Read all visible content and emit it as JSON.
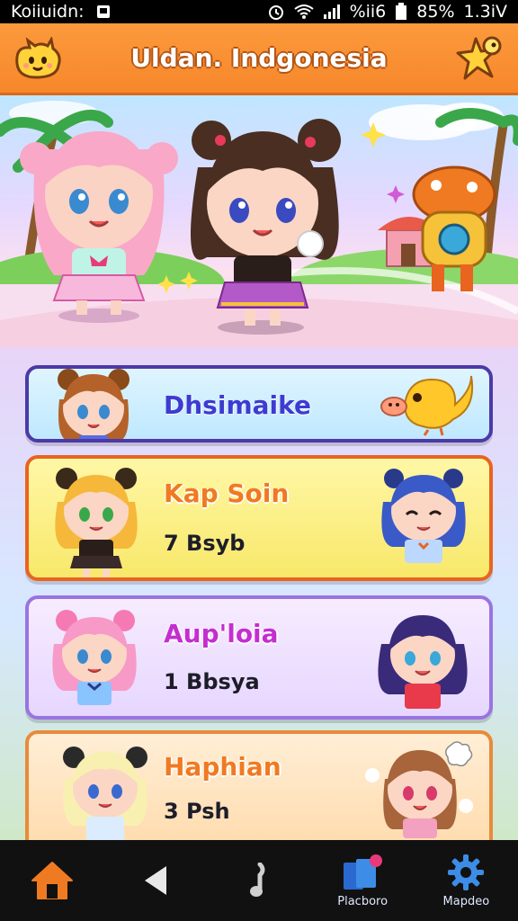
{
  "status_bar": {
    "left_text": "Koiiuidn:",
    "battery_text": "%ii6",
    "percent": "85%",
    "time": "1.3iV"
  },
  "header": {
    "title": "Uldan. Indgonesia",
    "left_icon": "mascot-icon",
    "right_icon": "star-sparkle-icon"
  },
  "cards": [
    {
      "title": "Dhsimaike",
      "subtitle": ""
    },
    {
      "title": "Kap Soin",
      "subtitle": "7 Bsyb"
    },
    {
      "title": "Aup'loia",
      "subtitle": "1 Bbsya"
    },
    {
      "title": "Haphian",
      "subtitle": "3 Psh"
    }
  ],
  "bottom_nav": {
    "items": [
      {
        "icon": "home-icon",
        "label": ""
      },
      {
        "icon": "back-icon",
        "label": ""
      },
      {
        "icon": "music-note-icon",
        "label": ""
      },
      {
        "icon": "cards-icon",
        "label": "Placboro"
      },
      {
        "icon": "gear-icon",
        "label": "Mapdeo"
      }
    ]
  },
  "colors": {
    "header": "#f7872b",
    "nav_accent": "#3d8de6",
    "home_icon": "#f07a21"
  }
}
